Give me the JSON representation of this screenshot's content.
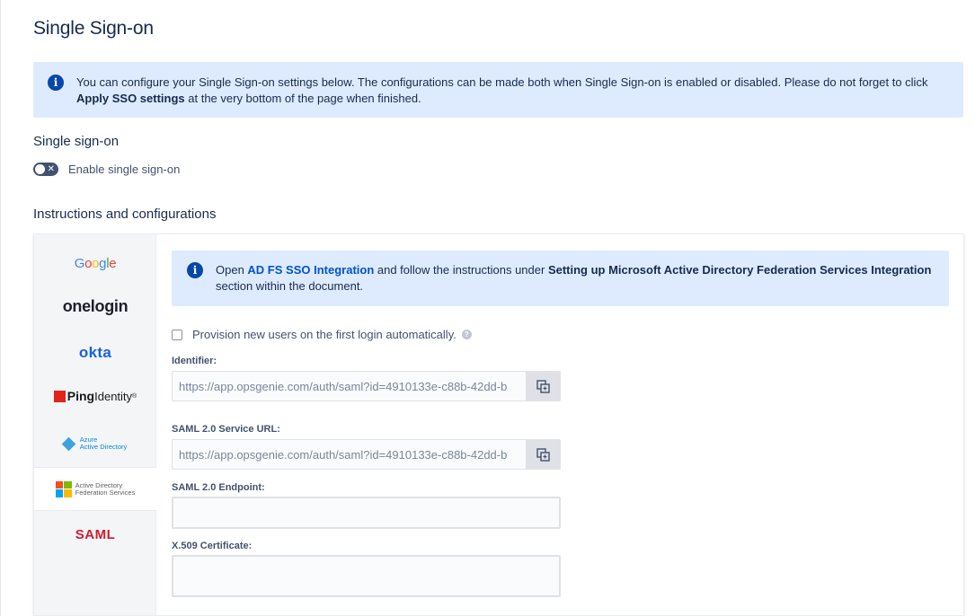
{
  "page": {
    "title": "Single Sign-on"
  },
  "top_banner": {
    "text_before": "You can configure your Single Sign-on settings below. The configurations can be made both when Single Sign-on is enabled or disabled. Please do not forget to click ",
    "bold": "Apply SSO settings",
    "text_after": " at the very bottom of the page when finished."
  },
  "sso_section": {
    "title": "Single sign-on",
    "toggle_label": "Enable single sign-on",
    "toggle_state": "off"
  },
  "instructions": {
    "title": "Instructions and configurations",
    "providers": [
      {
        "name": "Google"
      },
      {
        "name": "onelogin"
      },
      {
        "name": "okta"
      },
      {
        "name": "Ping",
        "suffix": "Identity"
      },
      {
        "name": "Azure",
        "line2": "Active Directory"
      },
      {
        "name": "Active Directory",
        "line2": "Federation Services",
        "active": true
      },
      {
        "name": "SAML"
      }
    ],
    "banner": {
      "open": "Open ",
      "link": "AD FS SSO Integration",
      "middle": " and follow the instructions under ",
      "bold": "Setting up Microsoft Active Directory Federation Services Integration",
      "end": " section within the document."
    },
    "provision_label": "Provision new users on the first login automatically.",
    "identifier": {
      "label": "Identifier:",
      "value": "https://app.opsgenie.com/auth/saml?id=4910133e-c88b-42dd-b"
    },
    "service_url": {
      "label": "SAML 2.0 Service URL:",
      "value": "https://app.opsgenie.com/auth/saml?id=4910133e-c88b-42dd-b"
    },
    "endpoint": {
      "label": "SAML 2.0 Endpoint:",
      "value": ""
    },
    "certificate": {
      "label": "X.509 Certificate:",
      "value": ""
    }
  },
  "icons": {
    "info": "info-icon",
    "copy": "copy-icon",
    "help": "help-icon",
    "close": "x-icon"
  },
  "colors": {
    "banner_bg": "#deebff",
    "info_icon": "#0747a6",
    "link": "#0052cc",
    "toggle_off": "#42526e"
  }
}
